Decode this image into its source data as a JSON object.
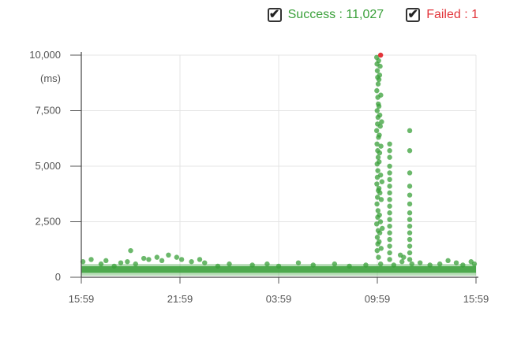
{
  "legend": {
    "success": {
      "label": "Success : 11,027",
      "color": "#3aa03a",
      "checked": true,
      "icon": "check-icon"
    },
    "failed": {
      "label": "Failed : 1",
      "color": "#e2343a",
      "checked": true,
      "icon": "check-icon"
    }
  },
  "chart_data": {
    "type": "scatter",
    "xlabel": "",
    "ylabel": "",
    "y_unit": "(ms)",
    "ylim": [
      0,
      10000
    ],
    "y_ticks": [
      0,
      2500,
      5000,
      7500,
      10000
    ],
    "y_tick_labels": [
      "0",
      "2,500",
      "5,000",
      "7,500",
      "10,000"
    ],
    "xlim": [
      "15:59",
      "15:59"
    ],
    "x_tick_labels": [
      "15:59",
      "21:59",
      "03:59",
      "09:59",
      "15:59"
    ],
    "grid": true,
    "series": [
      {
        "name": "Success",
        "color": "#3aa03a",
        "count": 11027,
        "points": [
          [
            0.1,
            700
          ],
          [
            0.6,
            800
          ],
          [
            1.2,
            600
          ],
          [
            1.5,
            750
          ],
          [
            2.0,
            500
          ],
          [
            2.4,
            650
          ],
          [
            2.8,
            700
          ],
          [
            3.0,
            1200
          ],
          [
            3.3,
            600
          ],
          [
            3.8,
            850
          ],
          [
            4.1,
            800
          ],
          [
            4.6,
            900
          ],
          [
            4.9,
            750
          ],
          [
            5.3,
            1000
          ],
          [
            5.8,
            900
          ],
          [
            6.1,
            800
          ],
          [
            6.7,
            700
          ],
          [
            7.2,
            800
          ],
          [
            7.5,
            650
          ],
          [
            8.3,
            500
          ],
          [
            9.0,
            600
          ],
          [
            10.4,
            550
          ],
          [
            11.3,
            600
          ],
          [
            12.0,
            500
          ],
          [
            13.2,
            650
          ],
          [
            14.1,
            550
          ],
          [
            15.4,
            600
          ],
          [
            16.3,
            500
          ],
          [
            17.3,
            550
          ],
          [
            18.2,
            600
          ],
          [
            19.0,
            550
          ],
          [
            20.1,
            600
          ],
          [
            20.6,
            650
          ],
          [
            21.2,
            550
          ],
          [
            21.8,
            600
          ],
          [
            22.3,
            750
          ],
          [
            22.8,
            650
          ],
          [
            23.2,
            550
          ],
          [
            23.7,
            700
          ],
          [
            23.9,
            600
          ],
          [
            17.96,
            9900
          ],
          [
            17.98,
            9600
          ],
          [
            18.0,
            9300
          ],
          [
            18.02,
            9000
          ],
          [
            18.05,
            8700
          ],
          [
            17.97,
            8400
          ],
          [
            18.03,
            8100
          ],
          [
            18.06,
            7800
          ],
          [
            17.99,
            7500
          ],
          [
            18.04,
            7200
          ],
          [
            18.01,
            6900
          ],
          [
            17.96,
            6600
          ],
          [
            18.07,
            6300
          ],
          [
            17.98,
            6000
          ],
          [
            18.02,
            5700
          ],
          [
            18.05,
            5400
          ],
          [
            17.99,
            5100
          ],
          [
            18.03,
            4800
          ],
          [
            18.0,
            4500
          ],
          [
            17.97,
            4200
          ],
          [
            18.06,
            3900
          ],
          [
            18.01,
            3600
          ],
          [
            17.98,
            3300
          ],
          [
            18.04,
            3000
          ],
          [
            18.02,
            2700
          ],
          [
            17.96,
            2400
          ],
          [
            18.05,
            2100
          ],
          [
            18.0,
            1800
          ],
          [
            18.03,
            1500
          ],
          [
            17.99,
            1200
          ],
          [
            18.07,
            900
          ],
          [
            18.08,
            9750
          ],
          [
            18.1,
            8900
          ],
          [
            18.1,
            7700
          ],
          [
            18.12,
            6400
          ],
          [
            18.11,
            5200
          ],
          [
            18.1,
            4000
          ],
          [
            18.13,
            2800
          ],
          [
            18.11,
            1600
          ],
          [
            18.14,
            9100
          ],
          [
            18.15,
            7300
          ],
          [
            18.14,
            5600
          ],
          [
            18.16,
            3800
          ],
          [
            18.15,
            2000
          ],
          [
            18.17,
            9500
          ],
          [
            18.18,
            6800
          ],
          [
            18.2,
            4600
          ],
          [
            18.19,
            2500
          ],
          [
            18.21,
            8200
          ],
          [
            18.22,
            5900
          ],
          [
            18.24,
            3500
          ],
          [
            18.23,
            1300
          ],
          [
            18.26,
            7000
          ],
          [
            18.28,
            4300
          ],
          [
            18.3,
            2200
          ],
          [
            18.75,
            6000
          ],
          [
            18.75,
            5700
          ],
          [
            18.75,
            5400
          ],
          [
            18.75,
            5000
          ],
          [
            18.75,
            4700
          ],
          [
            18.75,
            4400
          ],
          [
            18.75,
            4100
          ],
          [
            18.75,
            3800
          ],
          [
            18.75,
            3500
          ],
          [
            18.75,
            3200
          ],
          [
            18.75,
            2900
          ],
          [
            18.75,
            2600
          ],
          [
            18.75,
            2300
          ],
          [
            18.75,
            2000
          ],
          [
            18.75,
            1700
          ],
          [
            18.75,
            1400
          ],
          [
            18.75,
            1100
          ],
          [
            18.75,
            800
          ],
          [
            19.4,
            1000
          ],
          [
            19.5,
            700
          ],
          [
            19.6,
            900
          ],
          [
            19.97,
            6600
          ],
          [
            19.97,
            5700
          ],
          [
            19.97,
            4700
          ],
          [
            19.97,
            4100
          ],
          [
            19.97,
            3700
          ],
          [
            19.97,
            3300
          ],
          [
            19.97,
            2900
          ],
          [
            19.97,
            2600
          ],
          [
            19.97,
            2300
          ],
          [
            19.97,
            2000
          ],
          [
            19.97,
            1700
          ],
          [
            19.97,
            1400
          ],
          [
            19.97,
            1100
          ],
          [
            19.97,
            800
          ]
        ]
      },
      {
        "name": "Failed",
        "color": "#e2343a",
        "count": 1,
        "points": [
          [
            18.2,
            10000
          ]
        ]
      }
    ]
  }
}
